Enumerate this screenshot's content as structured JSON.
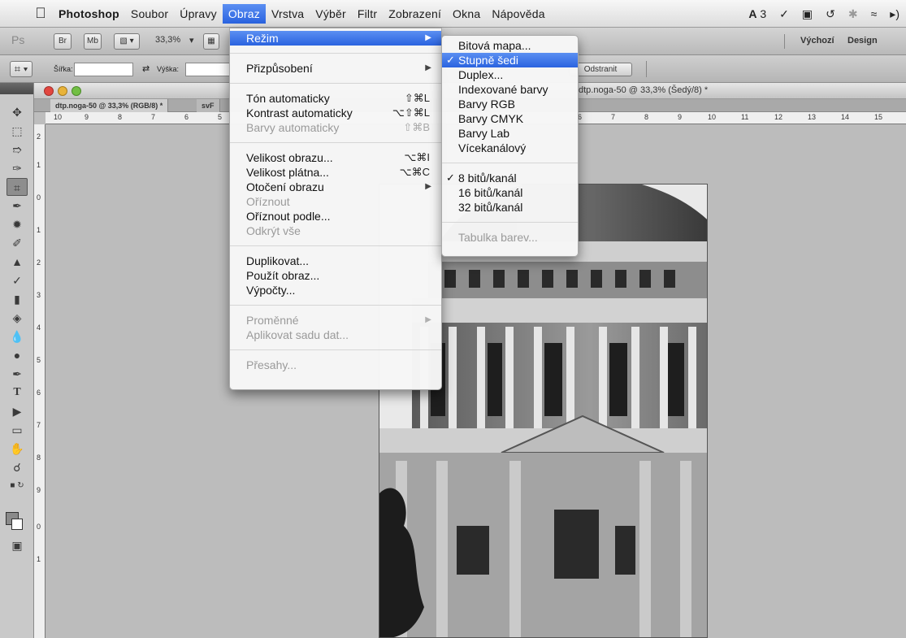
{
  "menubar": {
    "app": "Photoshop",
    "items": [
      "Soubor",
      "Úpravy",
      "Obraz",
      "Vrstva",
      "Výběr",
      "Filtr",
      "Zobrazení",
      "Okna",
      "Nápověda"
    ],
    "active": "Obraz",
    "status": {
      "adobe_count": "3"
    }
  },
  "appbar": {
    "bridge": "Br",
    "minibridge": "Mb",
    "zoom": "33,3%",
    "workspaces": [
      "Výchozí",
      "Design"
    ]
  },
  "optbar": {
    "width_label": "Šířka:",
    "height_label": "Výška:",
    "clear_button": "Odstranit"
  },
  "document": {
    "title": "dtp.noga-50 @ 33,3% (Šedý/8) *",
    "tabs": [
      "dtp.noga-50 @ 33,3% (RGB/8) *",
      "svF"
    ],
    "hruler": [
      "10",
      "9",
      "8",
      "7",
      "6",
      "5",
      "6",
      "7",
      "8",
      "9",
      "10",
      "11",
      "12",
      "13",
      "14",
      "15"
    ],
    "vruler": [
      "2",
      "1",
      "0",
      "1",
      "2",
      "3",
      "4",
      "5",
      "6",
      "7",
      "8",
      "9",
      "0",
      "1"
    ]
  },
  "obraz_menu": {
    "rezim": "Režim",
    "prizpusobeni": "Přizpůsobení",
    "ton": {
      "label": "Tón automaticky",
      "shortcut": "⇧⌘L"
    },
    "kontrast": {
      "label": "Kontrast automaticky",
      "shortcut": "⌥⇧⌘L"
    },
    "barvy": {
      "label": "Barvy automaticky",
      "shortcut": "⇧⌘B"
    },
    "velikost_obrazu": {
      "label": "Velikost obrazu...",
      "shortcut": "⌥⌘I"
    },
    "velikost_platna": {
      "label": "Velikost plátna...",
      "shortcut": "⌥⌘C"
    },
    "otoceni": "Otočení obrazu",
    "oriznout": "Oříznout",
    "oriznout_podle": "Oříznout podle...",
    "odkryt": "Odkrýt vše",
    "duplikovat": "Duplikovat...",
    "pouzit": "Použít obraz...",
    "vypocty": "Výpočty...",
    "promenne": "Proměnné",
    "aplikovat": "Aplikovat sadu dat...",
    "presahy": "Přesahy..."
  },
  "rezim_menu": {
    "bitova": "Bitová mapa...",
    "stupne": "Stupně šedi",
    "duplex": "Duplex...",
    "indexovane": "Indexované barvy",
    "rgb": "Barvy RGB",
    "cmyk": "Barvy CMYK",
    "lab": "Barvy Lab",
    "vicekanalovy": "Vícekanálový",
    "b8": "8 bitů/kanál",
    "b16": "16 bitů/kanál",
    "b32": "32 bitů/kanál",
    "tabulka": "Tabulka barev..."
  }
}
